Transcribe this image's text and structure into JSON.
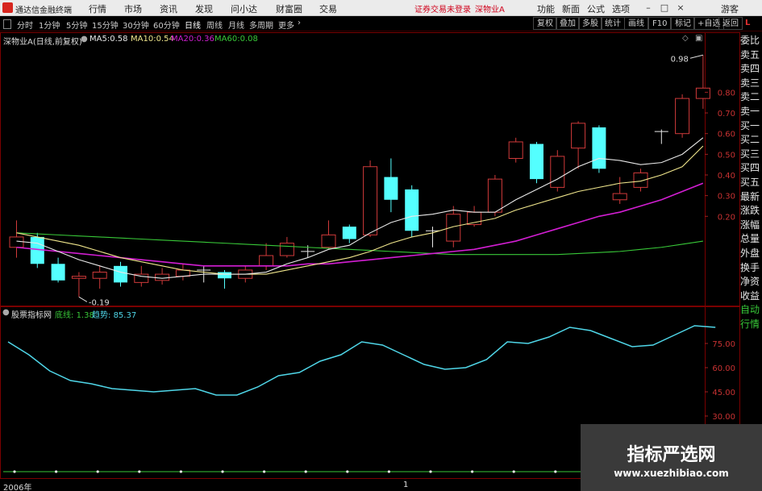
{
  "app": {
    "title": "通达信金融终端"
  },
  "menu": {
    "items": [
      "行情",
      "市场",
      "资讯",
      "发现",
      "问小达",
      "财富圈",
      "交易"
    ]
  },
  "notice": {
    "text": "证券交易未登录",
    "stock": "深物业A"
  },
  "titlebar_buttons": [
    "功能",
    "新面",
    "公式",
    "选项"
  ],
  "user": {
    "label": "游客"
  },
  "period_tabs": [
    "分时",
    "1分钟",
    "5分钟",
    "15分钟",
    "30分钟",
    "60分钟",
    "日线",
    "周线",
    "月线",
    "多周期",
    "更多"
  ],
  "active_tab": "日线",
  "toolbar_right": [
    "复权",
    "叠加",
    "多股",
    "统计",
    "画线",
    "F10",
    "标记",
    "+自选",
    "返回"
  ],
  "side_label": "L",
  "main_chart": {
    "stock_title": "深物业A(日线,前复权)",
    "ma": [
      {
        "label": "MA5:",
        "value": "0.58",
        "color": "#e8e8e8"
      },
      {
        "label": "MA10:",
        "value": "0.54",
        "color": "#f0e68c"
      },
      {
        "label": "MA20:",
        "value": "0.36",
        "color": "#d21ed2"
      },
      {
        "label": "MA60:",
        "value": "0.08",
        "color": "#38c838"
      }
    ],
    "high_label": "0.98",
    "low_label": "-0.19"
  },
  "indicator": {
    "title": "股票指标网",
    "items": [
      {
        "label": "底线:",
        "value": "1.38",
        "color": "#38c838"
      },
      {
        "label": "趋势:",
        "value": "85.37",
        "color": "#4fd6e8"
      }
    ]
  },
  "bottom_axis": {
    "start_label": "2006年",
    "mark": "1"
  },
  "watermark": {
    "title": "指标严选网",
    "url": "www.xuezhibiao.com"
  },
  "right_panel": [
    "委比",
    "卖五",
    "卖四",
    "卖三",
    "卖二",
    "卖一",
    "买一",
    "买二",
    "买三",
    "买四",
    "买五",
    "最新",
    "涨跌",
    "涨幅",
    "总量",
    "外盘",
    "换手",
    "净资",
    "收益",
    "自动",
    "行情"
  ],
  "chart_data": [
    {
      "type": "candlestick",
      "title": "深物业A(日线,前复权)",
      "y_ticks": [
        "0.80",
        "0.70",
        "0.60",
        "0.50",
        "0.40",
        "0.30",
        "0.20"
      ],
      "ylim": [
        -0.22,
        1.02
      ],
      "candles": [
        {
          "o": 0.05,
          "c": 0.1,
          "h": 0.18,
          "l": 0.0
        },
        {
          "o": 0.1,
          "c": -0.03,
          "h": 0.12,
          "l": -0.05
        },
        {
          "o": -0.03,
          "c": -0.11,
          "h": 0.0,
          "l": -0.12
        },
        {
          "o": -0.1,
          "c": -0.09,
          "h": -0.07,
          "l": -0.19
        },
        {
          "o": -0.1,
          "c": -0.07,
          "h": -0.04,
          "l": -0.15
        },
        {
          "o": -0.04,
          "c": -0.12,
          "h": -0.02,
          "l": -0.14
        },
        {
          "o": -0.12,
          "c": -0.08,
          "h": -0.04,
          "l": -0.14
        },
        {
          "o": -0.11,
          "c": -0.08,
          "h": -0.05,
          "l": -0.13
        },
        {
          "o": -0.09,
          "c": -0.06,
          "h": -0.03,
          "l": -0.11
        },
        {
          "o": -0.06,
          "c": -0.06,
          "h": -0.04,
          "l": -0.12
        },
        {
          "o": -0.07,
          "c": -0.1,
          "h": -0.06,
          "l": -0.15
        },
        {
          "o": -0.1,
          "c": -0.06,
          "h": -0.04,
          "l": -0.12
        },
        {
          "o": -0.04,
          "c": 0.01,
          "h": 0.07,
          "l": -0.06
        },
        {
          "o": 0.01,
          "c": 0.07,
          "h": 0.1,
          "l": 0.0
        },
        {
          "o": 0.03,
          "c": 0.03,
          "h": 0.06,
          "l": 0.0
        },
        {
          "o": 0.05,
          "c": 0.11,
          "h": 0.18,
          "l": 0.04
        },
        {
          "o": 0.15,
          "c": 0.09,
          "h": 0.16,
          "l": 0.07
        },
        {
          "o": 0.11,
          "c": 0.44,
          "h": 0.47,
          "l": 0.1
        },
        {
          "o": 0.39,
          "c": 0.28,
          "h": 0.48,
          "l": 0.22
        },
        {
          "o": 0.33,
          "c": 0.13,
          "h": 0.35,
          "l": 0.1
        },
        {
          "o": 0.13,
          "c": 0.13,
          "h": 0.15,
          "l": 0.05
        },
        {
          "o": 0.08,
          "c": 0.21,
          "h": 0.25,
          "l": 0.05
        },
        {
          "o": 0.16,
          "c": 0.22,
          "h": 0.25,
          "l": 0.15
        },
        {
          "o": 0.22,
          "c": 0.38,
          "h": 0.4,
          "l": 0.2
        },
        {
          "o": 0.48,
          "c": 0.56,
          "h": 0.58,
          "l": 0.46
        },
        {
          "o": 0.55,
          "c": 0.38,
          "h": 0.56,
          "l": 0.36
        },
        {
          "o": 0.34,
          "c": 0.49,
          "h": 0.52,
          "l": 0.32
        },
        {
          "o": 0.53,
          "c": 0.65,
          "h": 0.66,
          "l": 0.43
        },
        {
          "o": 0.63,
          "c": 0.43,
          "h": 0.64,
          "l": 0.41
        },
        {
          "o": 0.28,
          "c": 0.31,
          "h": 0.39,
          "l": 0.26
        },
        {
          "o": 0.34,
          "c": 0.41,
          "h": 0.43,
          "l": 0.32
        },
        {
          "o": 0.61,
          "c": 0.61,
          "h": 0.62,
          "l": 0.55
        },
        {
          "o": 0.6,
          "c": 0.77,
          "h": 0.79,
          "l": 0.58
        },
        {
          "o": 0.77,
          "c": 0.82,
          "h": 0.98,
          "l": 0.72
        }
      ],
      "ma5": [
        0.08,
        0.07,
        0.03,
        -0.01,
        -0.04,
        -0.07,
        -0.09,
        -0.1,
        -0.09,
        -0.08,
        -0.08,
        -0.08,
        -0.07,
        -0.03,
        0.0,
        0.04,
        0.06,
        0.12,
        0.17,
        0.2,
        0.21,
        0.23,
        0.22,
        0.22,
        0.28,
        0.33,
        0.38,
        0.44,
        0.48,
        0.47,
        0.45,
        0.46,
        0.5,
        0.58
      ],
      "ma10": [
        0.12,
        0.1,
        0.08,
        0.06,
        0.03,
        0.0,
        -0.02,
        -0.04,
        -0.06,
        -0.07,
        -0.08,
        -0.08,
        -0.08,
        -0.06,
        -0.04,
        -0.02,
        0.0,
        0.03,
        0.07,
        0.1,
        0.12,
        0.15,
        0.17,
        0.19,
        0.23,
        0.26,
        0.29,
        0.32,
        0.34,
        0.36,
        0.37,
        0.4,
        0.44,
        0.54
      ],
      "ma20": [
        0.05,
        0.04,
        0.03,
        0.02,
        0.01,
        0.0,
        -0.01,
        -0.02,
        -0.03,
        -0.04,
        -0.04,
        -0.04,
        -0.04,
        -0.04,
        -0.03,
        -0.03,
        -0.02,
        -0.01,
        0.0,
        0.01,
        0.02,
        0.03,
        0.04,
        0.06,
        0.08,
        0.11,
        0.14,
        0.17,
        0.2,
        0.22,
        0.25,
        0.28,
        0.32,
        0.36
      ],
      "ma60": [
        0.12,
        0.115,
        0.11,
        0.105,
        0.1,
        0.095,
        0.09,
        0.085,
        0.08,
        0.075,
        0.07,
        0.065,
        0.06,
        0.055,
        0.05,
        0.045,
        0.04,
        0.035,
        0.03,
        0.025,
        0.02,
        0.015,
        0.015,
        0.015,
        0.015,
        0.015,
        0.015,
        0.02,
        0.025,
        0.03,
        0.04,
        0.05,
        0.065,
        0.08
      ]
    },
    {
      "type": "line",
      "title": "股票指标网",
      "y_ticks": [
        "75.00",
        "60.00",
        "45.00",
        "30.00"
      ],
      "ylim": [
        28,
        92
      ],
      "series": [
        {
          "name": "趋势",
          "color": "#4fd6e8",
          "values": [
            76,
            68,
            58,
            52,
            50,
            47,
            46,
            45,
            46,
            47,
            43,
            43,
            48,
            55,
            57,
            64,
            68,
            76,
            74,
            68,
            62,
            59,
            60,
            65,
            76,
            75,
            79,
            85,
            83,
            78,
            73,
            74,
            80,
            86,
            85
          ]
        },
        {
          "name": "底线",
          "color": "#38c838",
          "values": [
            1.38,
            1.38,
            1.38,
            1.38,
            1.38,
            1.38,
            1.38,
            1.38,
            1.38,
            1.38,
            1.38,
            1.38,
            1.38,
            1.38,
            1.38,
            1.38,
            1.38,
            1.38,
            1.38,
            1.38,
            1.38,
            1.38,
            1.38,
            1.38,
            1.38,
            1.38,
            1.38,
            1.38,
            1.38,
            1.38,
            1.38,
            1.38,
            1.38,
            1.38,
            1.38
          ]
        }
      ]
    }
  ]
}
